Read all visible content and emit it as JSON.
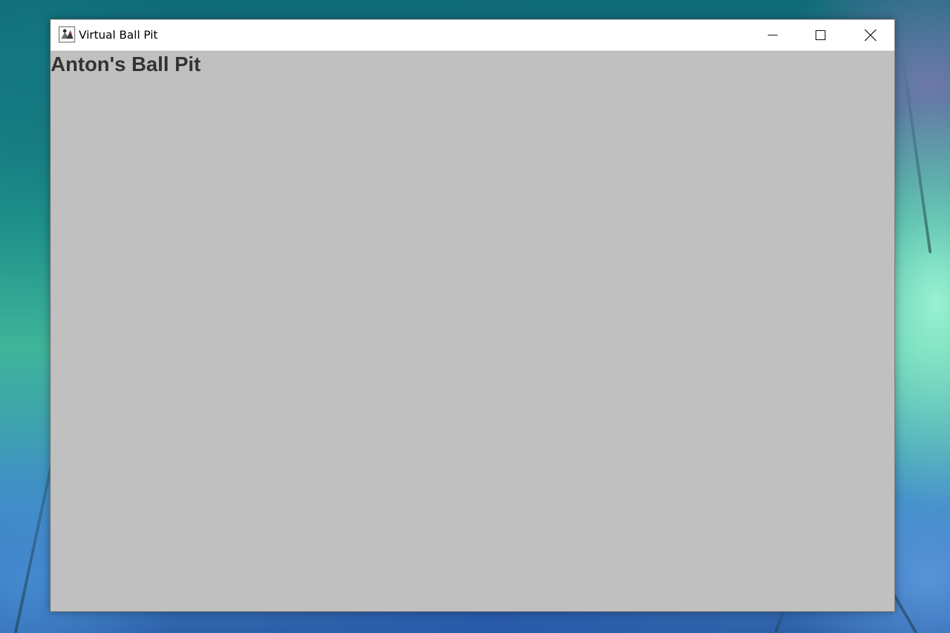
{
  "window": {
    "title": "Virtual Ball Pit",
    "app_icon": "java-duke-icon",
    "controls": {
      "minimize_icon": "minimize-icon",
      "maximize_icon": "maximize-icon",
      "close_icon": "close-icon"
    }
  },
  "canvas": {
    "heading": "Anton's Ball Pit",
    "background_color": "#c0c0c0",
    "heading_color": "#333333"
  },
  "desktop": {
    "wallpaper": "teal-green-blue-floral-wallpaper"
  }
}
